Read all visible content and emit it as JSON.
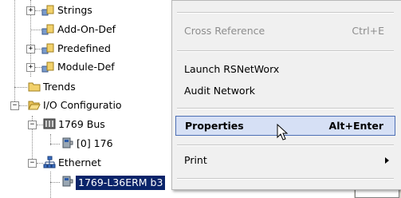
{
  "tree": {
    "strings": "Strings",
    "add_on": "Add-On-Def",
    "predefined": "Predefined",
    "module_def": "Module-Def",
    "trends": "Trends",
    "io_config": "I/O Configuratio",
    "bus": "1769 Bus",
    "bus_child": "[0] 176",
    "ethernet": "Ethernet",
    "controller": "1769-L36ERM b3"
  },
  "menu": {
    "cross_reference": "Cross Reference",
    "cross_reference_shortcut": "Ctrl+E",
    "launch_rsnetworx": "Launch RSNetWorx",
    "audit_network": "Audit Network",
    "properties": "Properties",
    "properties_shortcut": "Alt+Enter",
    "print": "Print"
  },
  "icons": {
    "folder": "folder-icon",
    "data_types": "data-types-icon",
    "chassis": "chassis-icon",
    "module": "module-icon",
    "network": "network-icon",
    "cursor": "mouse-cursor-icon"
  },
  "colors": {
    "selection": "#0a246a",
    "menu_highlight": "#d6e0f5",
    "menu_highlight_border": "#4d6fb4",
    "folder": "#f2d16b"
  }
}
